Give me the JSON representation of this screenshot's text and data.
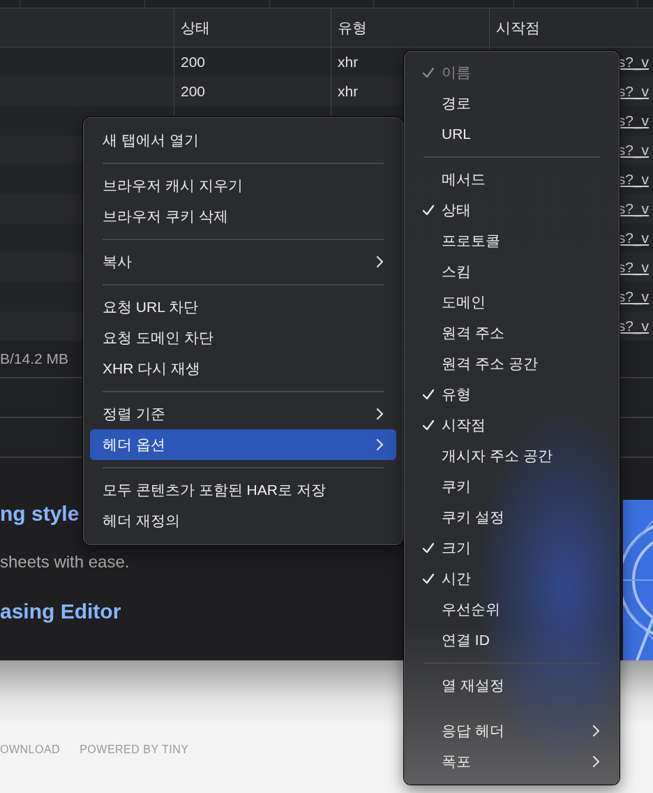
{
  "network_table": {
    "columns": [
      {
        "label": "상태"
      },
      {
        "label": "유형"
      },
      {
        "label": "시작점"
      }
    ],
    "rows": [
      {
        "status": "200",
        "type": "xhr",
        "initiator": "s?_v"
      },
      {
        "status": "200",
        "type": "xhr",
        "initiator": "s?_v"
      },
      {
        "initiator": "s?_v"
      },
      {
        "initiator": "s?_v"
      },
      {
        "initiator": "s?_v"
      },
      {
        "initiator": "s?_v"
      },
      {
        "initiator": "s?_v"
      },
      {
        "initiator": "s?_v"
      },
      {
        "initiator": "s?_v"
      },
      {
        "initiator": "s?_v"
      }
    ],
    "summary": "B/14.2 MB"
  },
  "page_content": {
    "heading_1": "ng style",
    "text": "sheets with ease.",
    "heading_2": "asing Editor"
  },
  "footer": {
    "links": [
      "OWNLOAD",
      "POWERED BY TINY"
    ]
  },
  "context_menu": {
    "items": [
      {
        "kind": "item",
        "label": "새 탭에서 열기",
        "submenu": false,
        "selected": false
      },
      {
        "kind": "separator"
      },
      {
        "kind": "item",
        "label": "브라우저 캐시 지우기",
        "submenu": false,
        "selected": false
      },
      {
        "kind": "item",
        "label": "브라우저 쿠키 삭제",
        "submenu": false,
        "selected": false
      },
      {
        "kind": "separator"
      },
      {
        "kind": "item",
        "label": "복사",
        "submenu": true,
        "selected": false
      },
      {
        "kind": "separator"
      },
      {
        "kind": "item",
        "label": "요청 URL 차단",
        "submenu": false,
        "selected": false
      },
      {
        "kind": "item",
        "label": "요청 도메인 차단",
        "submenu": false,
        "selected": false
      },
      {
        "kind": "item",
        "label": "XHR 다시 재생",
        "submenu": false,
        "selected": false
      },
      {
        "kind": "separator"
      },
      {
        "kind": "item",
        "label": "정렬 기준",
        "submenu": true,
        "selected": false
      },
      {
        "kind": "item",
        "label": "헤더 옵션",
        "submenu": true,
        "selected": true
      },
      {
        "kind": "separator"
      },
      {
        "kind": "item",
        "label": "모두 콘텐츠가 포함된 HAR로 저장",
        "submenu": false,
        "selected": false
      },
      {
        "kind": "item",
        "label": "헤더 재정의",
        "submenu": false,
        "selected": false
      }
    ]
  },
  "header_menu": {
    "items": [
      {
        "kind": "item",
        "label": "이름",
        "checked": true,
        "disabled": true,
        "submenu": false
      },
      {
        "kind": "item",
        "label": "경로",
        "checked": false,
        "disabled": false,
        "submenu": false
      },
      {
        "kind": "item",
        "label": "URL",
        "checked": false,
        "disabled": false,
        "submenu": false
      },
      {
        "kind": "separator"
      },
      {
        "kind": "item",
        "label": "메서드",
        "checked": false,
        "disabled": false,
        "submenu": false
      },
      {
        "kind": "item",
        "label": "상태",
        "checked": true,
        "disabled": false,
        "submenu": false
      },
      {
        "kind": "item",
        "label": "프로토콜",
        "checked": false,
        "disabled": false,
        "submenu": false
      },
      {
        "kind": "item",
        "label": "스킴",
        "checked": false,
        "disabled": false,
        "submenu": false
      },
      {
        "kind": "item",
        "label": "도메인",
        "checked": false,
        "disabled": false,
        "submenu": false
      },
      {
        "kind": "item",
        "label": "원격 주소",
        "checked": false,
        "disabled": false,
        "submenu": false
      },
      {
        "kind": "item",
        "label": "원격 주소 공간",
        "checked": false,
        "disabled": false,
        "submenu": false
      },
      {
        "kind": "item",
        "label": "유형",
        "checked": true,
        "disabled": false,
        "submenu": false
      },
      {
        "kind": "item",
        "label": "시작점",
        "checked": true,
        "disabled": false,
        "submenu": false
      },
      {
        "kind": "item",
        "label": "개시자 주소 공간",
        "checked": false,
        "disabled": false,
        "submenu": false
      },
      {
        "kind": "item",
        "label": "쿠키",
        "checked": false,
        "disabled": false,
        "submenu": false
      },
      {
        "kind": "item",
        "label": "쿠키 설정",
        "checked": false,
        "disabled": false,
        "submenu": false
      },
      {
        "kind": "item",
        "label": "크기",
        "checked": true,
        "disabled": false,
        "submenu": false
      },
      {
        "kind": "item",
        "label": "시간",
        "checked": true,
        "disabled": false,
        "submenu": false
      },
      {
        "kind": "item",
        "label": "우선순위",
        "checked": false,
        "disabled": false,
        "submenu": false
      },
      {
        "kind": "item",
        "label": "연결 ID",
        "checked": false,
        "disabled": false,
        "submenu": false
      },
      {
        "kind": "separator"
      },
      {
        "kind": "item",
        "label": "열 재설정",
        "checked": false,
        "disabled": false,
        "submenu": false
      },
      {
        "kind": "separator"
      },
      {
        "kind": "item",
        "label": "응답 헤더",
        "checked": false,
        "disabled": false,
        "submenu": true
      },
      {
        "kind": "item",
        "label": "폭포",
        "checked": false,
        "disabled": false,
        "submenu": true
      }
    ]
  }
}
